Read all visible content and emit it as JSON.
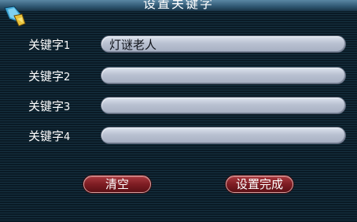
{
  "window": {
    "title": "设置关键字"
  },
  "fields": [
    {
      "label": "关键字",
      "index": "1",
      "value": "灯谜老人"
    },
    {
      "label": "关键字",
      "index": "2",
      "value": ""
    },
    {
      "label": "关键字",
      "index": "3",
      "value": ""
    },
    {
      "label": "关键字",
      "index": "4",
      "value": ""
    }
  ],
  "buttons": {
    "clear_label": "清空",
    "done_label": "设置完成"
  },
  "icons": {
    "logo": "quill-logo-icon"
  },
  "colors": {
    "input_fill": "#b9c1d1",
    "button_fill": "#7e1d23",
    "label_text": "#ffffff"
  }
}
